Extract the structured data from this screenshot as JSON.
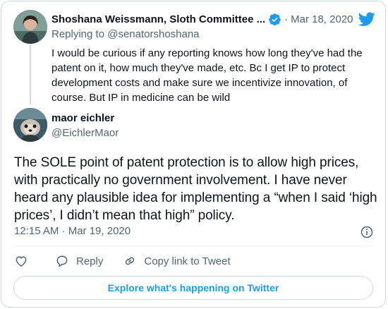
{
  "parent_tweet": {
    "author_name": "Shoshana Weissmann, Sloth Committee ...",
    "date": "Mar 18, 2020",
    "separator": "·",
    "replying_to": "Replying to @senatorshoshana",
    "text": "I would be curious if any reporting knows how long they've had the patent on it, how much they've made, etc. Bc I get IP to protect development costs and make sure we incentivize innovation, of course. But IP in medicine can be wild",
    "verified_icon": "verified-badge-icon",
    "brand_icon": "twitter-bird-icon"
  },
  "main_tweet": {
    "author_name": "maor eichler",
    "handle": "@EichlerMaor",
    "text": "The SOLE point of patent protection is to allow high prices, with practically no government involvement. I have never heard any plausible idea for implementing a “when I said ‘high prices’, I didn’t mean that high” policy.",
    "timestamp": "12:15 AM · Mar 19, 2020",
    "info_icon": "info-icon"
  },
  "actions": {
    "like_icon": "heart-icon",
    "reply_label": "Reply",
    "reply_icon": "speech-bubble-icon",
    "copy_label": "Copy link to Tweet",
    "copy_icon": "link-icon"
  },
  "footer": {
    "explore_label": "Explore what's happening on Twitter"
  },
  "colors": {
    "accent": "#1d9bf0",
    "text": "#0f1419",
    "muted": "#536471",
    "border": "#cfd9de"
  }
}
